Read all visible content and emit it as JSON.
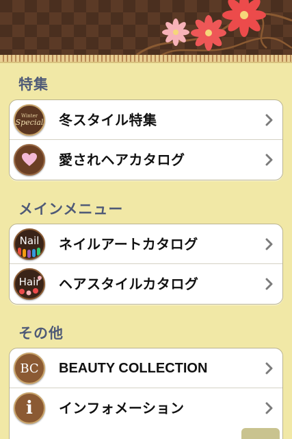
{
  "banner": {
    "colors": {
      "brown": "#4a2f1f",
      "diamond": "#5b3a26",
      "flower_red": "#ec4b4b",
      "flower_pink": "#f7b2b8"
    }
  },
  "sections": [
    {
      "title": "特集",
      "items": [
        {
          "label": "冬スタイル特集",
          "icon": "winter-special-icon",
          "icon_text_top": "Winter",
          "icon_text_main": "Special"
        },
        {
          "label": "愛されヘアカタログ",
          "icon": "heart-icon"
        }
      ]
    },
    {
      "title": "メインメニュー",
      "items": [
        {
          "label": "ネイルアートカタログ",
          "icon": "nail-icon",
          "icon_text_main": "Nail"
        },
        {
          "label": "ヘアスタイルカタログ",
          "icon": "hair-icon",
          "icon_text_main": "Hair"
        }
      ]
    },
    {
      "title": "その他",
      "items": [
        {
          "label": "BEAUTY COLLECTION",
          "icon": "beauty-collection-icon",
          "icon_text_main": "BC"
        },
        {
          "label": "インフォメーション",
          "icon": "information-icon",
          "icon_text_main": "i"
        }
      ]
    }
  ],
  "colors": {
    "background": "#f1e8a6",
    "section_title": "#4f5a77",
    "icon_brown": "#6b3f24"
  }
}
